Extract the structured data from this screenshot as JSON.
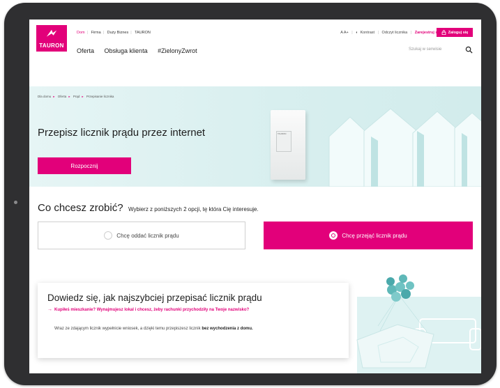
{
  "header": {
    "logo_text": "TAURON",
    "top_nav": [
      {
        "label": "Dom",
        "active": true
      },
      {
        "label": "Firma",
        "active": false
      },
      {
        "label": "Duży Biznes",
        "active": false
      },
      {
        "label": "TAURON",
        "active": false
      }
    ],
    "main_nav": [
      "Oferta",
      "Obsługa klienta",
      "#ZielonyZwrot"
    ],
    "util": {
      "font_size": "A A+",
      "contrast": "Kontrast",
      "meter_read": "Odczyt licznika",
      "register": "Zarejestruj się",
      "login": "Zaloguj się"
    },
    "search_placeholder": "Szukaj w serwisie"
  },
  "hero": {
    "breadcrumb": [
      "Dla domu",
      "Oferta",
      "Prąd",
      "Przepisanie licznika"
    ],
    "title": "Przepisz licznik prądu przez internet",
    "start_button": "Rozpocznij",
    "meter_label": "TAURON"
  },
  "question": {
    "main": "Co chcesz zrobić?",
    "sub": "Wybierz z poniższych 2 opcji, tę która Cię interesuje.",
    "options": [
      {
        "label": "Chcę oddać licznik prądu",
        "selected": false
      },
      {
        "label": "Chcę przejąć licznik prądu",
        "selected": true
      }
    ]
  },
  "info": {
    "title": "Dowiedz się, jak najszybciej przepisać licznik prądu",
    "question": "Kupiłeś mieszkanie? Wynajmujesz lokal i chcesz, żeby rachunki przychodziły na Twoje nazwisko?",
    "text_pre": "Wraz ze zdającym licznik wypełnicie wniosek, a dzięki temu przepiszesz licznik",
    "text_bold": "bez wychodzenia z domu."
  },
  "colors": {
    "brand": "#e2007a",
    "hero_bg": "#d8efef",
    "tablet": "#2f2f31"
  }
}
